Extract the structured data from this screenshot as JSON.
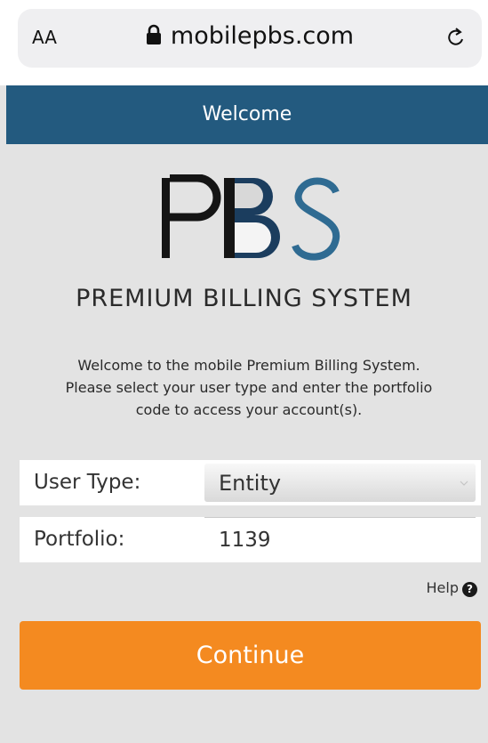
{
  "browser": {
    "text_size_label": "AA",
    "url": "mobilepbs.com"
  },
  "header": {
    "title": "Welcome"
  },
  "logo": {
    "wordmark": "PBS",
    "subtitle": "PREMIUM BILLING SYSTEM"
  },
  "intro": {
    "line1": "Welcome to the mobile Premium Billing System.",
    "line2": "Please select your user type and enter the portfolio",
    "line3": "code to access your account(s)."
  },
  "form": {
    "user_type_label": "User Type:",
    "user_type_value": "Entity",
    "portfolio_label": "Portfolio:",
    "portfolio_value": "1139"
  },
  "help": {
    "label": "Help",
    "icon": "question-circle-icon"
  },
  "actions": {
    "continue_label": "Continue"
  },
  "colors": {
    "header_bg": "#235a7f",
    "button_bg": "#f48a20",
    "page_bg": "#e3e3e3"
  }
}
